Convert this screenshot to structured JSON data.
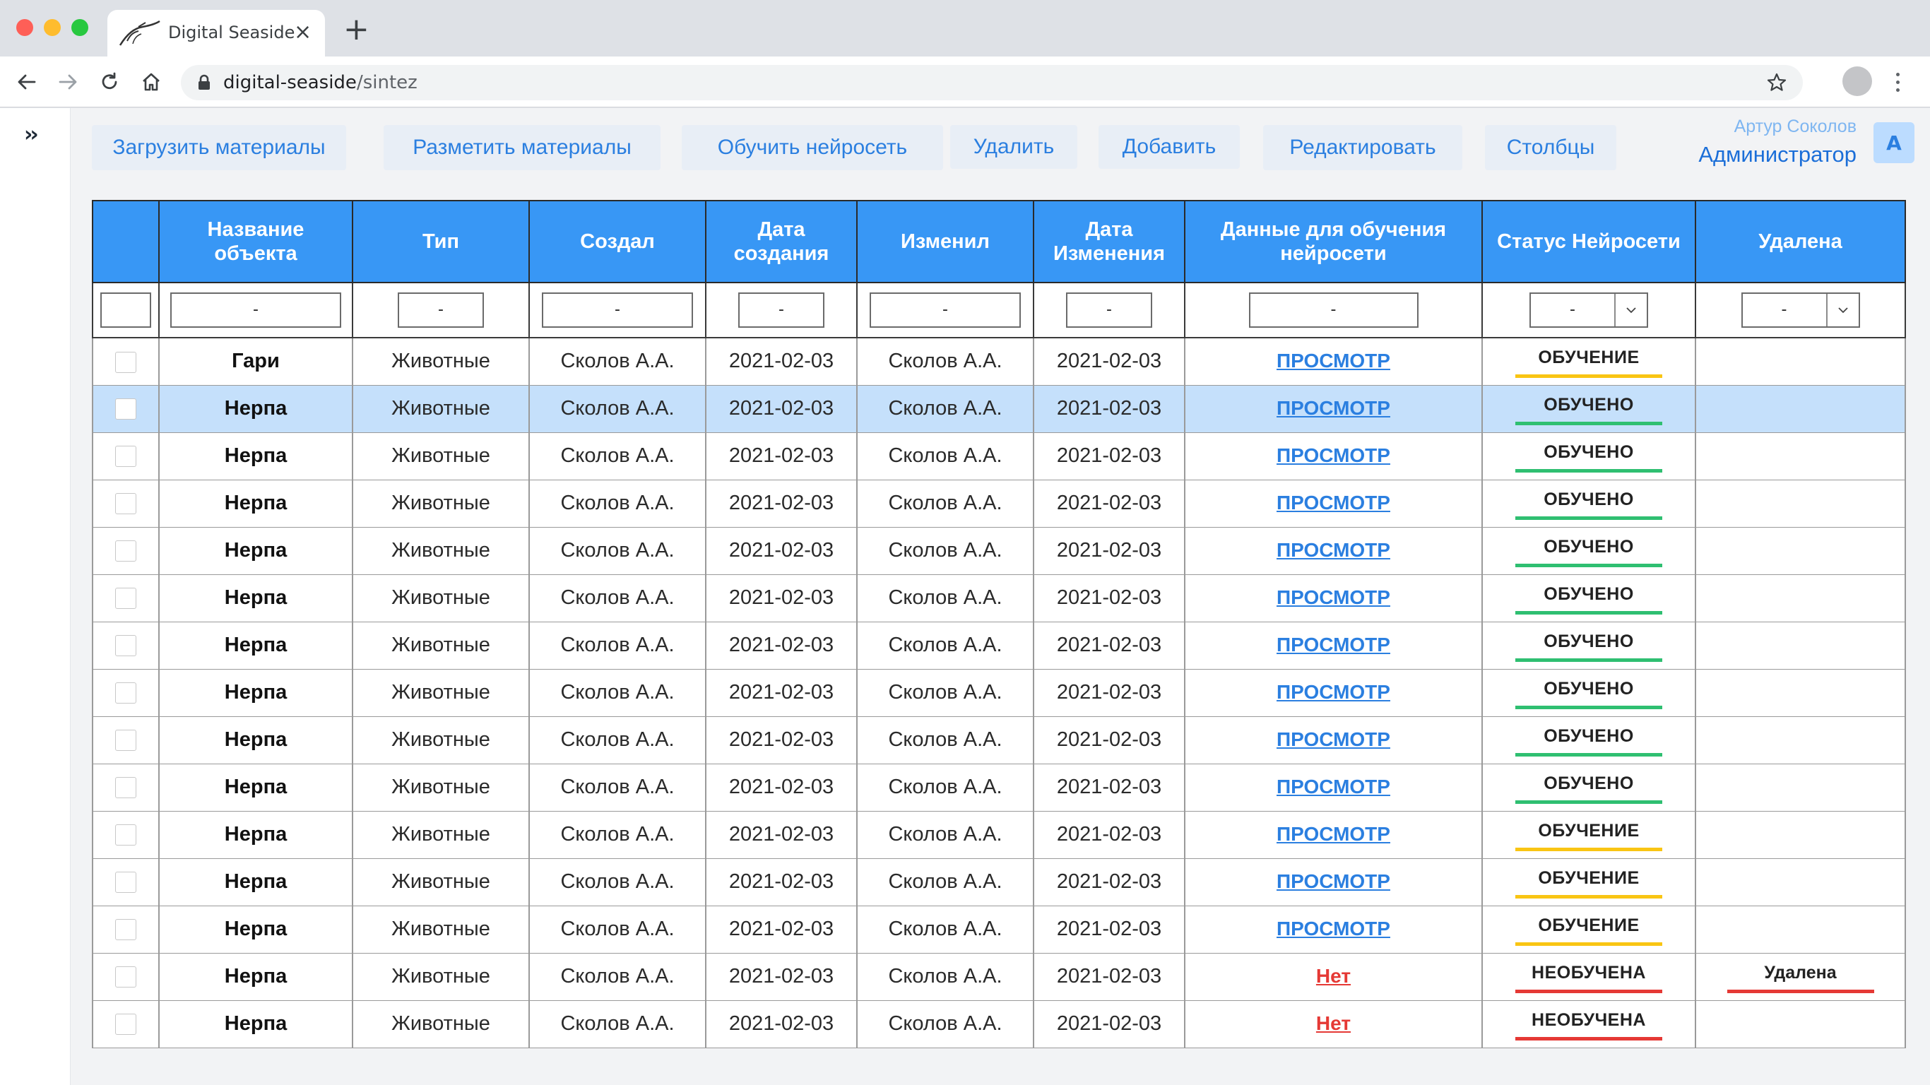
{
  "browser": {
    "tab_title": "Digital Seaside",
    "tab_close": "×",
    "new_tab": "+",
    "url_host": "digital-seaside",
    "url_path": "/sintez"
  },
  "sidebar": {
    "toggle": "››"
  },
  "toolbar": {
    "upload": "Загрузить материалы",
    "markup": "Разметить материалы",
    "train": "Обучить нейросеть",
    "delete": "Удалить",
    "add": "Добавить",
    "edit": "Редактировать",
    "columns": "Столбцы"
  },
  "user": {
    "name": "Артур Соколов",
    "role": "Администратор",
    "avatar_letter": "A"
  },
  "table": {
    "headers": {
      "name": "Название объекта",
      "type": "Тип",
      "created_by": "Создал",
      "created_date": "Дата создания",
      "modified_by": "Изменил",
      "modified_date": "Дата Изменения",
      "training_data": "Данные для обучения нейросети",
      "status": "Статус Нейросети",
      "deleted": "Удалена"
    },
    "filter_placeholder": "-",
    "rows": [
      {
        "name": "Гари",
        "type": "Животные",
        "created_by": "Сколов А.А.",
        "created_date": "2021-02-03",
        "modified_by": "Сколов А.А.",
        "modified_date": "2021-02-03",
        "data": "ПРОСМОТР",
        "data_kind": "view",
        "status": "ОБУЧЕНИЕ",
        "status_kind": "training",
        "deleted": "",
        "selected": false
      },
      {
        "name": "Нерпа",
        "type": "Животные",
        "created_by": "Сколов А.А.",
        "created_date": "2021-02-03",
        "modified_by": "Сколов А.А.",
        "modified_date": "2021-02-03",
        "data": "ПРОСМОТР",
        "data_kind": "view",
        "status": "ОБУЧЕНО",
        "status_kind": "trained",
        "deleted": "",
        "selected": true
      },
      {
        "name": "Нерпа",
        "type": "Животные",
        "created_by": "Сколов А.А.",
        "created_date": "2021-02-03",
        "modified_by": "Сколов А.А.",
        "modified_date": "2021-02-03",
        "data": "ПРОСМОТР",
        "data_kind": "view",
        "status": "ОБУЧЕНО",
        "status_kind": "trained",
        "deleted": "",
        "selected": false
      },
      {
        "name": "Нерпа",
        "type": "Животные",
        "created_by": "Сколов А.А.",
        "created_date": "2021-02-03",
        "modified_by": "Сколов А.А.",
        "modified_date": "2021-02-03",
        "data": "ПРОСМОТР",
        "data_kind": "view",
        "status": "ОБУЧЕНО",
        "status_kind": "trained",
        "deleted": "",
        "selected": false
      },
      {
        "name": "Нерпа",
        "type": "Животные",
        "created_by": "Сколов А.А.",
        "created_date": "2021-02-03",
        "modified_by": "Сколов А.А.",
        "modified_date": "2021-02-03",
        "data": "ПРОСМОТР",
        "data_kind": "view",
        "status": "ОБУЧЕНО",
        "status_kind": "trained",
        "deleted": "",
        "selected": false
      },
      {
        "name": "Нерпа",
        "type": "Животные",
        "created_by": "Сколов А.А.",
        "created_date": "2021-02-03",
        "modified_by": "Сколов А.А.",
        "modified_date": "2021-02-03",
        "data": "ПРОСМОТР",
        "data_kind": "view",
        "status": "ОБУЧЕНО",
        "status_kind": "trained",
        "deleted": "",
        "selected": false
      },
      {
        "name": "Нерпа",
        "type": "Животные",
        "created_by": "Сколов А.А.",
        "created_date": "2021-02-03",
        "modified_by": "Сколов А.А.",
        "modified_date": "2021-02-03",
        "data": "ПРОСМОТР",
        "data_kind": "view",
        "status": "ОБУЧЕНО",
        "status_kind": "trained",
        "deleted": "",
        "selected": false
      },
      {
        "name": "Нерпа",
        "type": "Животные",
        "created_by": "Сколов А.А.",
        "created_date": "2021-02-03",
        "modified_by": "Сколов А.А.",
        "modified_date": "2021-02-03",
        "data": "ПРОСМОТР",
        "data_kind": "view",
        "status": "ОБУЧЕНО",
        "status_kind": "trained",
        "deleted": "",
        "selected": false
      },
      {
        "name": "Нерпа",
        "type": "Животные",
        "created_by": "Сколов А.А.",
        "created_date": "2021-02-03",
        "modified_by": "Сколов А.А.",
        "modified_date": "2021-02-03",
        "data": "ПРОСМОТР",
        "data_kind": "view",
        "status": "ОБУЧЕНО",
        "status_kind": "trained",
        "deleted": "",
        "selected": false
      },
      {
        "name": "Нерпа",
        "type": "Животные",
        "created_by": "Сколов А.А.",
        "created_date": "2021-02-03",
        "modified_by": "Сколов А.А.",
        "modified_date": "2021-02-03",
        "data": "ПРОСМОТР",
        "data_kind": "view",
        "status": "ОБУЧЕНО",
        "status_kind": "trained",
        "deleted": "",
        "selected": false
      },
      {
        "name": "Нерпа",
        "type": "Животные",
        "created_by": "Сколов А.А.",
        "created_date": "2021-02-03",
        "modified_by": "Сколов А.А.",
        "modified_date": "2021-02-03",
        "data": "ПРОСМОТР",
        "data_kind": "view",
        "status": "ОБУЧЕНИЕ",
        "status_kind": "training",
        "deleted": "",
        "selected": false
      },
      {
        "name": "Нерпа",
        "type": "Животные",
        "created_by": "Сколов А.А.",
        "created_date": "2021-02-03",
        "modified_by": "Сколов А.А.",
        "modified_date": "2021-02-03",
        "data": "ПРОСМОТР",
        "data_kind": "view",
        "status": "ОБУЧЕНИЕ",
        "status_kind": "training",
        "deleted": "",
        "selected": false
      },
      {
        "name": "Нерпа",
        "type": "Животные",
        "created_by": "Сколов А.А.",
        "created_date": "2021-02-03",
        "modified_by": "Сколов А.А.",
        "modified_date": "2021-02-03",
        "data": "ПРОСМОТР",
        "data_kind": "view",
        "status": "ОБУЧЕНИЕ",
        "status_kind": "training",
        "deleted": "",
        "selected": false
      },
      {
        "name": "Нерпа",
        "type": "Животные",
        "created_by": "Сколов А.А.",
        "created_date": "2021-02-03",
        "modified_by": "Сколов А.А.",
        "modified_date": "2021-02-03",
        "data": "Нет",
        "data_kind": "none",
        "status": "НЕОБУЧЕНА",
        "status_kind": "untrained",
        "deleted": "Удалена",
        "selected": false
      },
      {
        "name": "Нерпа",
        "type": "Животные",
        "created_by": "Сколов А.А.",
        "created_date": "2021-02-03",
        "modified_by": "Сколов А.А.",
        "modified_date": "2021-02-03",
        "data": "Нет",
        "data_kind": "none",
        "status": "НЕОБУЧЕНА",
        "status_kind": "untrained",
        "deleted": "",
        "selected": false
      }
    ]
  },
  "colors": {
    "header_bg": "#3897f5",
    "accent": "#2b7fe0",
    "selected_row": "#c5e0fb",
    "status_training": "#f9c513",
    "status_trained": "#2fbf71",
    "status_untrained": "#e53935"
  },
  "icons": {
    "back": "arrow-left-icon",
    "forward": "arrow-right-icon",
    "reload": "reload-icon",
    "home": "home-icon",
    "lock": "lock-icon",
    "bookmark": "star-icon",
    "menu": "kebab-menu-icon",
    "dropdown": "chevron-down-icon"
  }
}
